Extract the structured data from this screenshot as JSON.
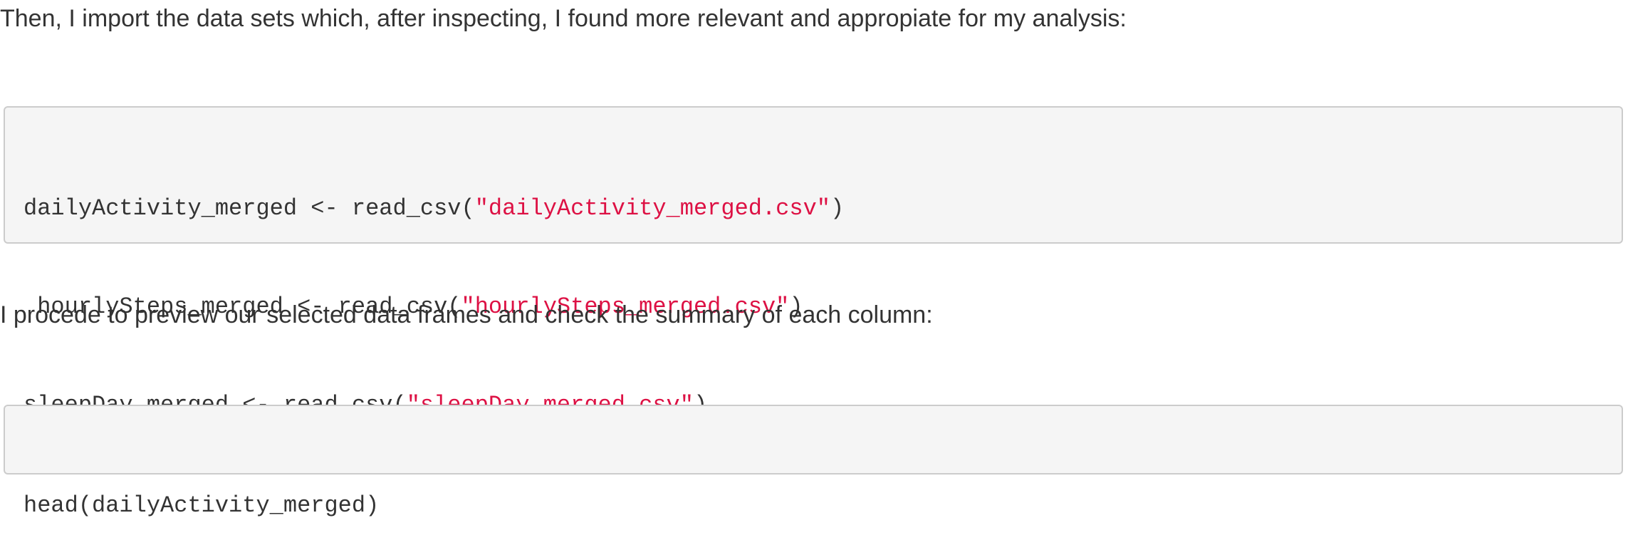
{
  "document": {
    "paragraphs": [
      "Then, I import the data sets which, after inspecting, I found more relevant and appropiate for my analysis:",
      "I procede to preview our selected data frames and check the summary of each column:"
    ],
    "code_blocks": [
      {
        "lines": [
          {
            "code": "dailyActivity_merged <- read_csv(",
            "string": "\"dailyActivity_merged.csv\"",
            "close": ")"
          },
          {
            "code": " hourlySteps_merged <- read_csv(",
            "string": "\"hourlySteps_merged.csv\"",
            "close": ")"
          },
          {
            "code": "sleepDay_merged <- read_csv(",
            "string": "\"sleepDay_merged.csv\"",
            "close": ")"
          }
        ]
      },
      {
        "lines": [
          {
            "code": "head(dailyActivity_merged)",
            "string": "",
            "close": ""
          }
        ]
      }
    ],
    "colors": {
      "text": "#333333",
      "code_background": "#f5f5f5",
      "code_border": "#cccccc",
      "string_literal": "#dd1144"
    }
  }
}
